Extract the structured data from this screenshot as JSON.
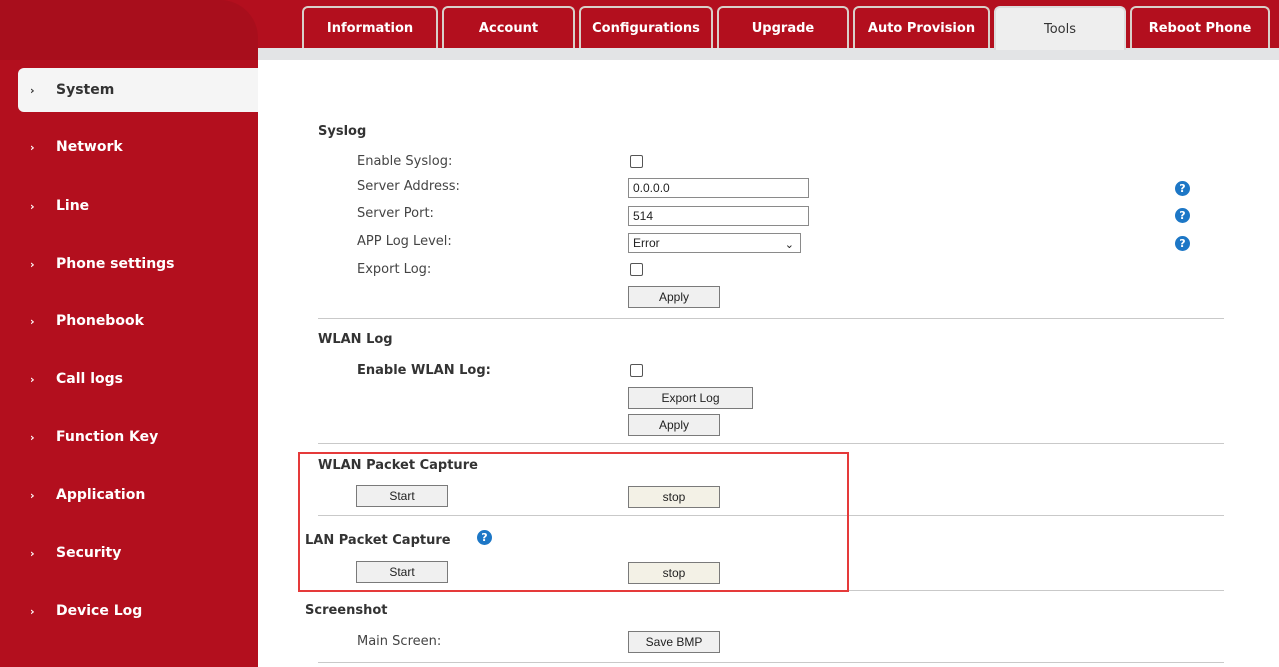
{
  "tabs": [
    {
      "label": "Information",
      "active": false
    },
    {
      "label": "Account",
      "active": false
    },
    {
      "label": "Configurations",
      "active": false
    },
    {
      "label": "Upgrade",
      "active": false
    },
    {
      "label": "Auto Provision",
      "active": false
    },
    {
      "label": "Tools",
      "active": true
    },
    {
      "label": "Reboot Phone",
      "active": false
    }
  ],
  "sidebar": {
    "items": [
      {
        "label": "System",
        "active": true
      },
      {
        "label": "Network"
      },
      {
        "label": "Line"
      },
      {
        "label": "Phone settings"
      },
      {
        "label": "Phonebook"
      },
      {
        "label": "Call logs"
      },
      {
        "label": "Function Key"
      },
      {
        "label": "Application"
      },
      {
        "label": "Security"
      },
      {
        "label": "Device Log"
      }
    ],
    "chevron": "›"
  },
  "syslog": {
    "title": "Syslog",
    "enable_label": "Enable Syslog:",
    "server_address_label": "Server Address:",
    "server_address_value": "0.0.0.0",
    "server_port_label": "Server Port:",
    "server_port_value": "514",
    "app_log_level_label": "APP Log Level:",
    "app_log_level_value": "Error",
    "export_log_label": "Export Log:",
    "apply_label": "Apply"
  },
  "wlan_log": {
    "title": "WLAN Log",
    "enable_label": "Enable WLAN Log:",
    "export_button": "Export Log",
    "apply_label": "Apply"
  },
  "wlan_capture": {
    "title": "WLAN Packet Capture",
    "start_label": "Start",
    "stop_label": "stop"
  },
  "lan_capture": {
    "title": "LAN Packet Capture",
    "start_label": "Start",
    "stop_label": "stop"
  },
  "screenshot": {
    "title": "Screenshot",
    "main_screen_label": "Main Screen:",
    "save_button": "Save BMP"
  },
  "help_glyph": "?",
  "caret_glyph": "⌄",
  "colors": {
    "brand_red": "#b30f1e",
    "highlight_border": "#e53a3a",
    "help_blue": "#1d77c6"
  }
}
